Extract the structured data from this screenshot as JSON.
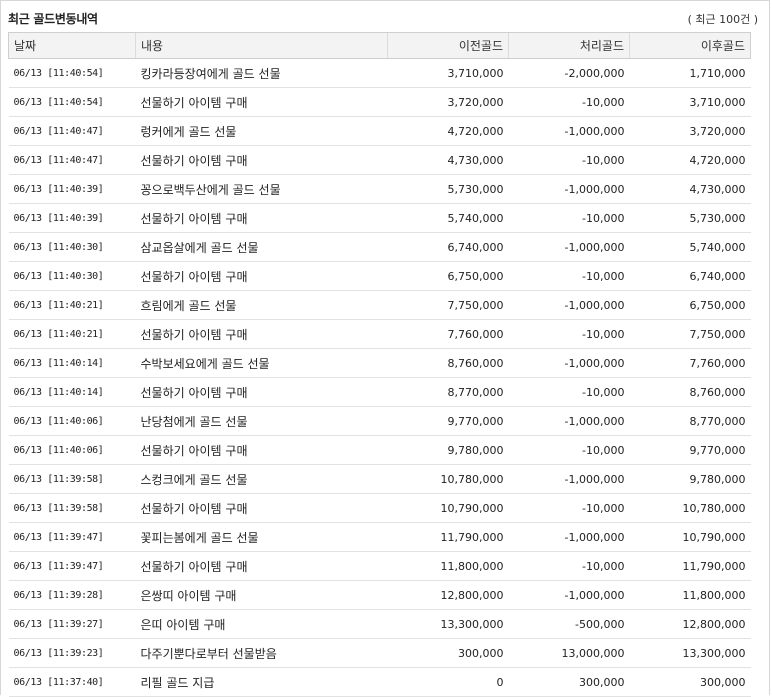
{
  "header": {
    "title": "최근 골드변동내역",
    "count": "( 최근 100건 )"
  },
  "table": {
    "columns": [
      "날짜",
      "내용",
      "이전골드",
      "처리골드",
      "이후골드"
    ],
    "rows": [
      {
        "date": "06/13 [11:40:54]",
        "desc": "킹카라등장여에게 골드 선물",
        "before": "3,710,000",
        "change": "-2,000,000",
        "after": "1,710,000"
      },
      {
        "date": "06/13 [11:40:54]",
        "desc": "선물하기 아이템 구매",
        "before": "3,720,000",
        "change": "-10,000",
        "after": "3,710,000"
      },
      {
        "date": "06/13 [11:40:47]",
        "desc": "렁커에게 골드 선물",
        "before": "4,720,000",
        "change": "-1,000,000",
        "after": "3,720,000"
      },
      {
        "date": "06/13 [11:40:47]",
        "desc": "선물하기 아이템 구매",
        "before": "4,730,000",
        "change": "-10,000",
        "after": "4,720,000"
      },
      {
        "date": "06/13 [11:40:39]",
        "desc": "꽁으로백두산에게 골드 선물",
        "before": "5,730,000",
        "change": "-1,000,000",
        "after": "4,730,000"
      },
      {
        "date": "06/13 [11:40:39]",
        "desc": "선물하기 아이템 구매",
        "before": "5,740,000",
        "change": "-10,000",
        "after": "5,730,000"
      },
      {
        "date": "06/13 [11:40:30]",
        "desc": "삼교옵살에게 골드 선물",
        "before": "6,740,000",
        "change": "-1,000,000",
        "after": "5,740,000"
      },
      {
        "date": "06/13 [11:40:30]",
        "desc": "선물하기 아이템 구매",
        "before": "6,750,000",
        "change": "-10,000",
        "after": "6,740,000"
      },
      {
        "date": "06/13 [11:40:21]",
        "desc": "흐림에게 골드 선물",
        "before": "7,750,000",
        "change": "-1,000,000",
        "after": "6,750,000"
      },
      {
        "date": "06/13 [11:40:21]",
        "desc": "선물하기 아이템 구매",
        "before": "7,760,000",
        "change": "-10,000",
        "after": "7,750,000"
      },
      {
        "date": "06/13 [11:40:14]",
        "desc": "수박보세요에게 골드 선물",
        "before": "8,760,000",
        "change": "-1,000,000",
        "after": "7,760,000"
      },
      {
        "date": "06/13 [11:40:14]",
        "desc": "선물하기 아이템 구매",
        "before": "8,770,000",
        "change": "-10,000",
        "after": "8,760,000"
      },
      {
        "date": "06/13 [11:40:06]",
        "desc": "난당첨에게 골드 선물",
        "before": "9,770,000",
        "change": "-1,000,000",
        "after": "8,770,000"
      },
      {
        "date": "06/13 [11:40:06]",
        "desc": "선물하기 아이템 구매",
        "before": "9,780,000",
        "change": "-10,000",
        "after": "9,770,000"
      },
      {
        "date": "06/13 [11:39:58]",
        "desc": "스컹크에게 골드 선물",
        "before": "10,780,000",
        "change": "-1,000,000",
        "after": "9,780,000"
      },
      {
        "date": "06/13 [11:39:58]",
        "desc": "선물하기 아이템 구매",
        "before": "10,790,000",
        "change": "-10,000",
        "after": "10,780,000"
      },
      {
        "date": "06/13 [11:39:47]",
        "desc": "꽃피는봄에게 골드 선물",
        "before": "11,790,000",
        "change": "-1,000,000",
        "after": "10,790,000"
      },
      {
        "date": "06/13 [11:39:47]",
        "desc": "선물하기 아이템 구매",
        "before": "11,800,000",
        "change": "-10,000",
        "after": "11,790,000"
      },
      {
        "date": "06/13 [11:39:28]",
        "desc": "은쌍띠 아이템 구매",
        "before": "12,800,000",
        "change": "-1,000,000",
        "after": "11,800,000"
      },
      {
        "date": "06/13 [11:39:27]",
        "desc": "은띠 아이템 구매",
        "before": "13,300,000",
        "change": "-500,000",
        "after": "12,800,000"
      },
      {
        "date": "06/13 [11:39:23]",
        "desc": "다주기뿐다로부터 선물받음",
        "before": "300,000",
        "change": "13,000,000",
        "after": "13,300,000"
      },
      {
        "date": "06/13 [11:37:40]",
        "desc": "리필 골드 지급",
        "before": "0",
        "change": "300,000",
        "after": "300,000"
      }
    ]
  }
}
